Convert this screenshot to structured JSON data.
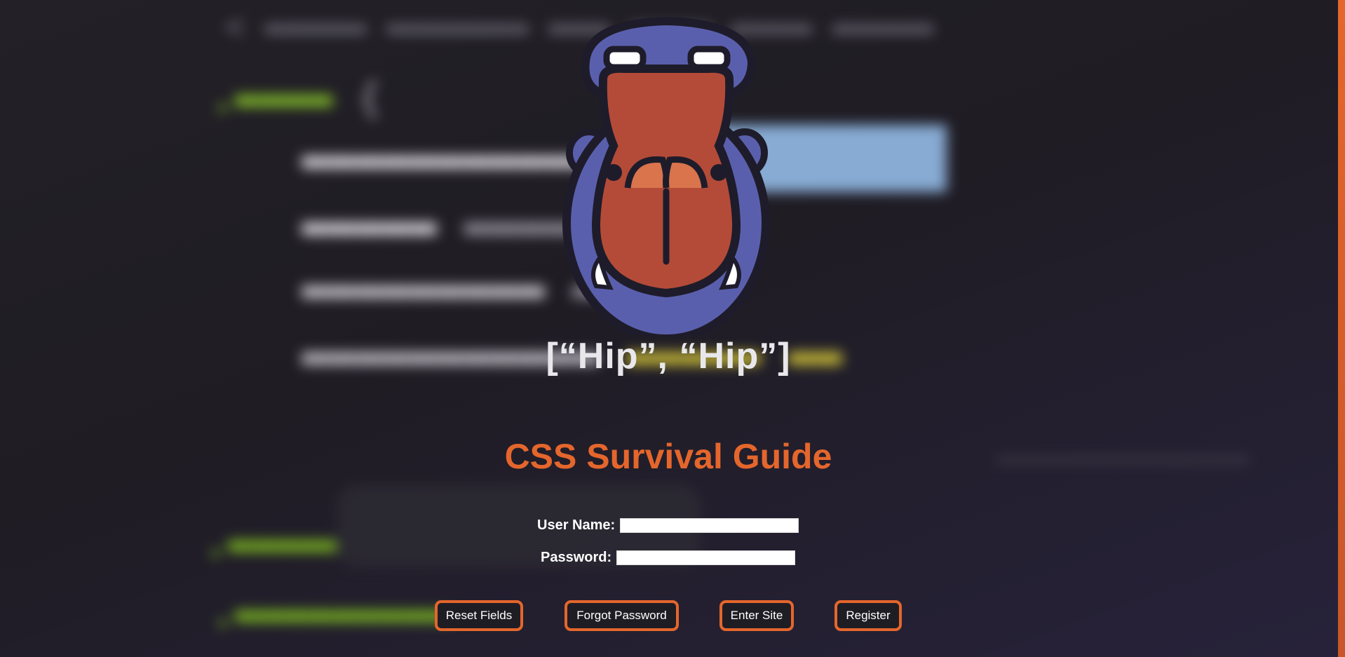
{
  "app": {
    "tagline": "[“Hip”, “Hip”]",
    "title": "CSS Survival Guide"
  },
  "form": {
    "username_label": "User Name:",
    "username_value": "",
    "password_label": "Password:",
    "password_value": ""
  },
  "buttons": {
    "reset": "Reset Fields",
    "forgot": "Forgot Password",
    "enter": "Enter Site",
    "register": "Register"
  },
  "colors": {
    "accent": "#e4662c",
    "background": "#1f1d24",
    "logo_blue": "#5a5fad",
    "logo_red": "#b44b38",
    "text": "#ffffff"
  },
  "icons": {
    "logo": "hippo-logo-icon"
  }
}
